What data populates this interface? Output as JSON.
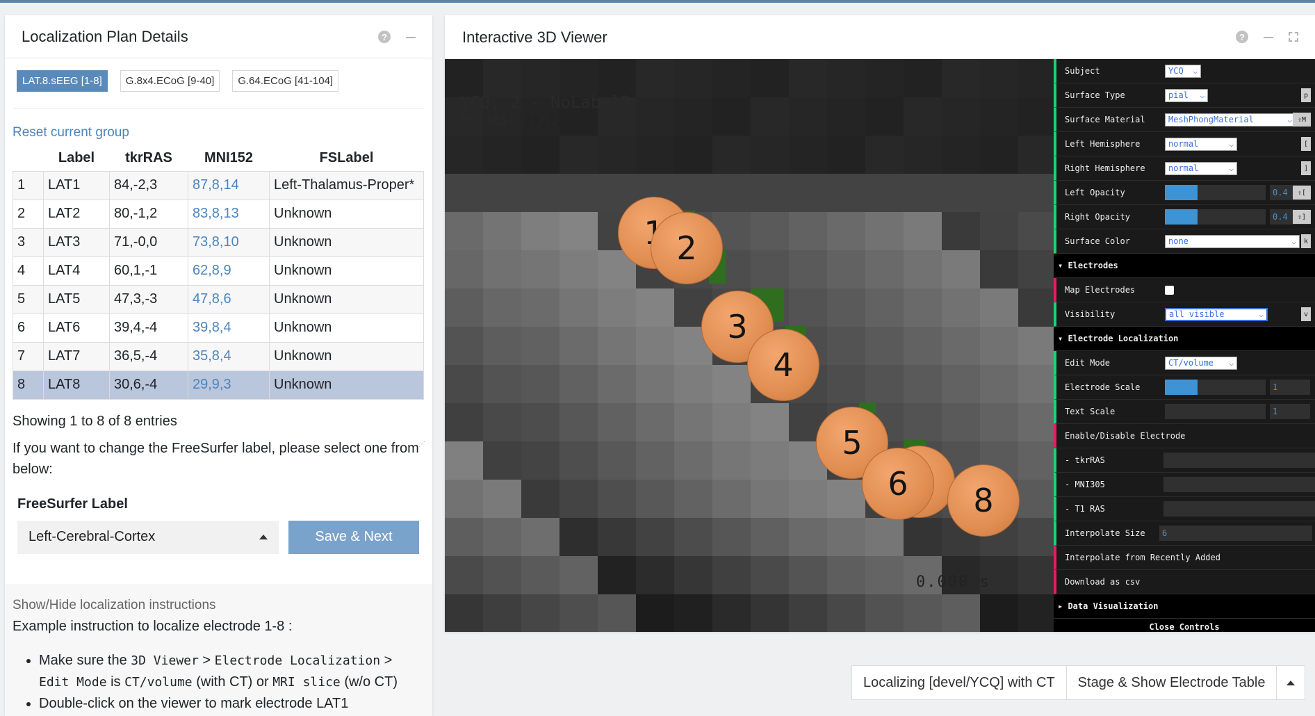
{
  "left_panel": {
    "title": "Localization Plan Details",
    "help_icon": "?",
    "tabs": [
      {
        "label": "LAT.8.sEEG [1-8]",
        "active": true
      },
      {
        "label": "G.8x4.ECoG [9-40]",
        "active": false
      },
      {
        "label": "G.64.ECoG [41-104]",
        "active": false
      }
    ],
    "reset_link": "Reset current group",
    "table": {
      "headers": [
        "",
        "Label",
        "tkrRAS",
        "MNI152",
        "FSLabel"
      ],
      "rows": [
        {
          "idx": "1",
          "label": "LAT1",
          "tkrras": "84,-2,3",
          "mni152": "87,8,14",
          "fslabel": "Left-Thalamus-Proper*"
        },
        {
          "idx": "2",
          "label": "LAT2",
          "tkrras": "80,-1,2",
          "mni152": "83,8,13",
          "fslabel": "Unknown"
        },
        {
          "idx": "3",
          "label": "LAT3",
          "tkrras": "71,-0,0",
          "mni152": "73,8,10",
          "fslabel": "Unknown"
        },
        {
          "idx": "4",
          "label": "LAT4",
          "tkrras": "60,1,-1",
          "mni152": "62,8,9",
          "fslabel": "Unknown"
        },
        {
          "idx": "5",
          "label": "LAT5",
          "tkrras": "47,3,-3",
          "mni152": "47,8,6",
          "fslabel": "Unknown"
        },
        {
          "idx": "6",
          "label": "LAT6",
          "tkrras": "39,4,-4",
          "mni152": "39,8,4",
          "fslabel": "Unknown"
        },
        {
          "idx": "7",
          "label": "LAT7",
          "tkrras": "36,5,-4",
          "mni152": "35,8,4",
          "fslabel": "Unknown"
        },
        {
          "idx": "8",
          "label": "LAT8",
          "tkrras": "30,6,-4",
          "mni152": "29,9,3",
          "fslabel": "Unknown"
        }
      ],
      "selected_row": 8
    },
    "entries_text": "Showing 1 to 8 of 8 entries",
    "change_text": "If you want to change the FreeSurfer label, please select one from below:",
    "fs_label_title": "FreeSurfer Label",
    "fs_label_value": "Left-Cerebral-Cortex",
    "save_button": "Save & Next",
    "instructions": {
      "toggle": "Show/Hide localization instructions",
      "title": "Example instruction to localize electrode 1-8 :",
      "item1": {
        "t1": "Make sure the ",
        "c1": "3D Viewer",
        "t2": " > ",
        "c2": "Electrode Localization",
        "t3": " > ",
        "c3": "Edit Mode",
        "t4": " is ",
        "c4": "CT/volume",
        "t5": " (with CT) or ",
        "c5": "MRI slice",
        "t6": " (w/o CT)"
      },
      "item2": "Double-click on the viewer to mark electrode LAT1"
    }
  },
  "viewer": {
    "title": "Interactive 3D Viewer",
    "help_icon": "?",
    "info_line1": "YCQ, 2 - NoLabel2",
    "info_prefix": "MNI305: ",
    "info_coords": "29,7,2",
    "time": "0.000 s",
    "electrodes": [
      "1",
      "2",
      "3",
      "4",
      "5",
      "6",
      "7",
      "8"
    ]
  },
  "controls": {
    "subject_label": "Subject",
    "subject_value": "YCQ",
    "surface_type_label": "Surface Type",
    "surface_type_value": "pial",
    "surface_type_key": "p",
    "surface_material_label": "Surface Material",
    "surface_material_value": "MeshPhongMaterial",
    "surface_material_key": "⇧M",
    "left_hemi_label": "Left Hemisphere",
    "left_hemi_value": "normal",
    "left_hemi_key": "[",
    "right_hemi_label": "Right Hemisphere",
    "right_hemi_value": "normal",
    "right_hemi_key": "]",
    "left_opacity_label": "Left Opacity",
    "left_opacity_value": "0.4",
    "left_opacity_key": "⇧[",
    "right_opacity_label": "Right Opacity",
    "right_opacity_value": "0.4",
    "right_opacity_key": "⇧]",
    "surface_color_label": "Surface Color",
    "surface_color_value": "none",
    "surface_color_key": "k",
    "electrodes_folder": "Electrodes",
    "map_electrodes_label": "Map Electrodes",
    "visibility_label": "Visibility",
    "visibility_value": "all visible",
    "visibility_key": "v",
    "loc_folder": "Electrode Localization",
    "edit_mode_label": "Edit Mode",
    "edit_mode_value": "CT/volume",
    "electrode_scale_label": "Electrode Scale",
    "electrode_scale_value": "1",
    "text_scale_label": "Text Scale",
    "text_scale_value": "1",
    "enable_disable_label": "Enable/Disable Electrode",
    "tkrras_label": "- tkrRAS",
    "mni305_label": "- MNI305",
    "t1ras_label": "- T1 RAS",
    "interp_size_label": "Interpolate Size",
    "interp_size_value": "6",
    "interp_recent_label": "Interpolate from Recently Added",
    "download_label": "Download as csv",
    "data_vis_folder": "Data Visualization",
    "close_controls": "Close Controls"
  },
  "status_bar": {
    "localizing": "Localizing [devel/YCQ] with CT",
    "stage": "Stage & Show Electrode Table"
  },
  "colors": {
    "accent": "#5b8ab8",
    "link": "#4d84bd",
    "selected_row": "#b9c6dc",
    "electrode": "#e18e52",
    "controller_green": "#1ed36f",
    "controller_pink": "#e61d5f",
    "slider_blue": "#3e93d5"
  }
}
